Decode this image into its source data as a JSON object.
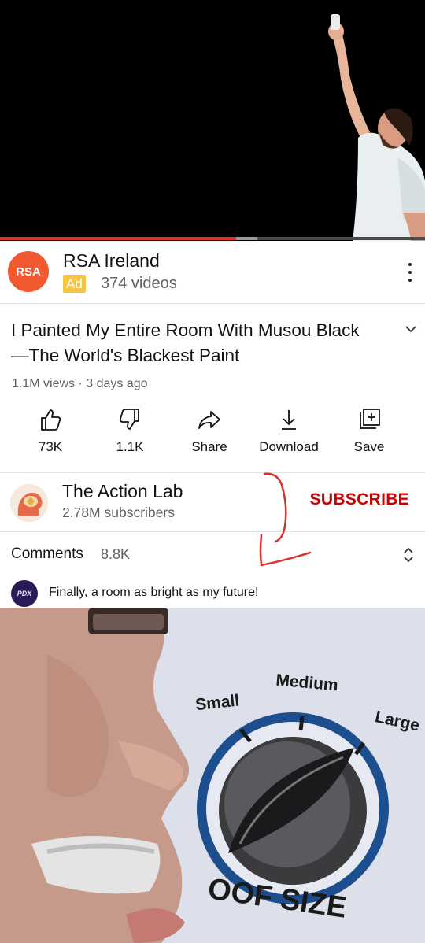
{
  "ad": {
    "logo_text": "RSA",
    "channel": "RSA Ireland",
    "badge": "Ad",
    "videos": "374 videos"
  },
  "player": {
    "progress": 0.555,
    "buffered": 0.605
  },
  "video": {
    "title": "I Painted My Entire Room With Musou Black —The World's Blackest Paint",
    "meta": "1.1M views · 3 days ago"
  },
  "actions": [
    {
      "label": "73K",
      "icon": "thumbs-up-icon"
    },
    {
      "label": "1.1K",
      "icon": "thumbs-down-icon"
    },
    {
      "label": "Share",
      "icon": "share-icon"
    },
    {
      "label": "Download",
      "icon": "download-icon"
    },
    {
      "label": "Save",
      "icon": "save-playlist-icon"
    }
  ],
  "channel": {
    "name": "The Action Lab",
    "subscribers": "2.78M subscribers",
    "subscribe_label": "SUBSCRIBE"
  },
  "comments": {
    "heading": "Comments",
    "count": "8.8K",
    "top_comment": {
      "avatar_text": "PDX",
      "text": "Finally, a room as bright as my future!"
    }
  },
  "meme": {
    "labels": {
      "small": "Small",
      "medium": "Medium",
      "large": "Large"
    },
    "caption": "OOF SIZE"
  },
  "colors": {
    "progress": "#e0302a",
    "subscribe": "#cc0000",
    "ad_badge": "#f6c543",
    "rsa_logo": "#f15a30",
    "dial_ring": "#1d4f8e"
  }
}
